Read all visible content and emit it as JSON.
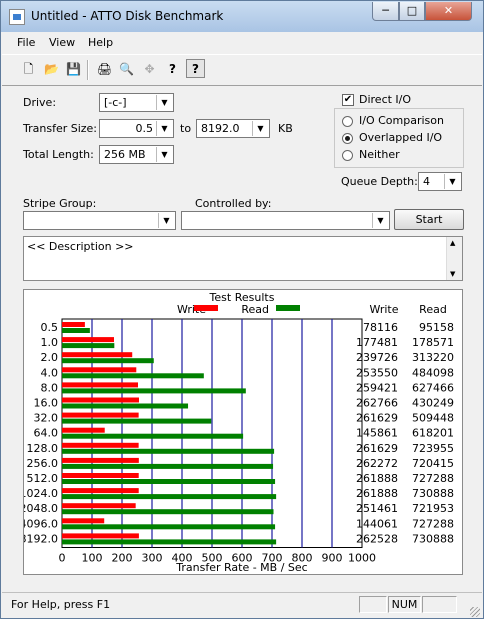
{
  "window": {
    "title": "Untitled - ATTO Disk Benchmark",
    "minimize_label": "─",
    "maximize_label": "□",
    "close_label": "✕"
  },
  "menu": {
    "file": "File",
    "view": "View",
    "help": "Help"
  },
  "toolbar": {
    "new": "🗋",
    "open": "📂",
    "save": "💾",
    "print": "🖨",
    "preview": "🔍",
    "move": "✥",
    "help": "?",
    "context_help": "?"
  },
  "form": {
    "drive_label": "Drive:",
    "drive_value": "[-c-]",
    "transfer_size_label": "Transfer Size:",
    "transfer_from": "0.5",
    "transfer_to_label": "to",
    "transfer_to": "8192.0",
    "transfer_unit": "KB",
    "total_length_label": "Total Length:",
    "total_length_value": "256 MB",
    "direct_io_label": "Direct I/O",
    "direct_io_checked": true,
    "io_comparison_label": "I/O Comparison",
    "overlapped_io_label": "Overlapped I/O",
    "neither_label": "Neither",
    "selected_mode": "Overlapped I/O",
    "queue_depth_label": "Queue Depth:",
    "queue_depth_value": "4",
    "stripe_group_label": "Stripe Group:",
    "stripe_group_value": "",
    "controlled_by_label": "Controlled by:",
    "controlled_by_value": "",
    "start_label": "Start",
    "description": "<< Description >>"
  },
  "status": {
    "help_text": "For Help, press F1",
    "num": "NUM"
  },
  "chart_data": {
    "type": "bar",
    "title": "Test Results",
    "xlabel": "Transfer Rate - MB / Sec",
    "xlim": [
      0,
      1000
    ],
    "xticks": [
      "0",
      "100",
      "200",
      "300",
      "400",
      "500",
      "600",
      "700",
      "800",
      "900",
      "1000"
    ],
    "legend": {
      "write": "Write",
      "read": "Read",
      "write_color": "#ff0000",
      "read_color": "#008000"
    },
    "col_write_header": "Write",
    "col_read_header": "Read",
    "categories": [
      "0.5",
      "1.0",
      "2.0",
      "4.0",
      "8.0",
      "16.0",
      "32.0",
      "64.0",
      "128.0",
      "256.0",
      "512.0",
      "1024.0",
      "2048.0",
      "4096.0",
      "8192.0"
    ],
    "series": [
      {
        "name": "Write",
        "values": [
          78116,
          177481,
          239726,
          253550,
          259421,
          262766,
          261629,
          145861,
          261629,
          262272,
          261888,
          261888,
          251461,
          144061,
          262528
        ]
      },
      {
        "name": "Read",
        "values": [
          95158,
          178571,
          313220,
          484098,
          627466,
          430249,
          509448,
          618201,
          723955,
          720415,
          727288,
          730888,
          721953,
          727288,
          730888
        ]
      }
    ]
  }
}
